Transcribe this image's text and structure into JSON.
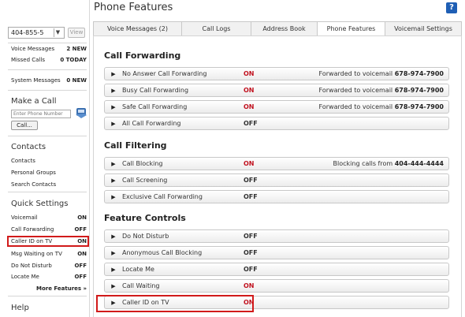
{
  "sidebar": {
    "phone_number": "404-855-5",
    "view_label": "View",
    "messages": [
      {
        "label": "Voice Messages",
        "value": "2 NEW"
      },
      {
        "label": "Missed Calls",
        "value": "0 TODAY"
      }
    ],
    "system_messages": {
      "label": "System Messages",
      "value": "0 NEW"
    },
    "make_call": {
      "heading": "Make a Call",
      "placeholder": "Enter Phone Number",
      "button": "Call..."
    },
    "contacts": {
      "heading": "Contacts",
      "links": [
        "Contacts",
        "Personal Groups",
        "Search Contacts"
      ]
    },
    "quick_settings": {
      "heading": "Quick Settings",
      "items": [
        {
          "label": "Voicemail",
          "value": "ON"
        },
        {
          "label": "Call Forwarding",
          "value": "OFF"
        },
        {
          "label": "Caller ID on TV",
          "value": "ON"
        },
        {
          "label": "Msg Waiting on TV",
          "value": "ON"
        },
        {
          "label": "Do Not Disturb",
          "value": "OFF"
        },
        {
          "label": "Locate Me",
          "value": "OFF"
        }
      ],
      "more": "More Features »"
    },
    "help": "Help"
  },
  "header": {
    "title": "Phone Features",
    "help_icon": "?"
  },
  "tabs": [
    "Voice Messages (2)",
    "Call Logs",
    "Address Book",
    "Phone Features",
    "Voicemail Settings"
  ],
  "sections": [
    {
      "title": "Call Forwarding",
      "rows": [
        {
          "name": "No Answer Call Forwarding",
          "status": "ON",
          "detail_text": "Forwarded to voicemail",
          "detail_bold": "678-974-7900"
        },
        {
          "name": "Busy Call Forwarding",
          "status": "ON",
          "detail_text": "Forwarded to voicemail",
          "detail_bold": "678-974-7900"
        },
        {
          "name": "Safe Call Forwarding",
          "status": "ON",
          "detail_text": "Forwarded to voicemail",
          "detail_bold": "678-974-7900"
        },
        {
          "name": "All Call Forwarding",
          "status": "OFF",
          "detail_text": "",
          "detail_bold": ""
        }
      ]
    },
    {
      "title": "Call Filtering",
      "rows": [
        {
          "name": "Call Blocking",
          "status": "ON",
          "detail_text": "Blocking calls from",
          "detail_bold": "404-444-4444"
        },
        {
          "name": "Call Screening",
          "status": "OFF",
          "detail_text": "",
          "detail_bold": ""
        },
        {
          "name": "Exclusive Call Forwarding",
          "status": "OFF",
          "detail_text": "",
          "detail_bold": ""
        }
      ]
    },
    {
      "title": "Feature Controls",
      "rows": [
        {
          "name": "Do Not Disturb",
          "status": "OFF",
          "detail_text": "",
          "detail_bold": ""
        },
        {
          "name": "Anonymous Call Blocking",
          "status": "OFF",
          "detail_text": "",
          "detail_bold": ""
        },
        {
          "name": "Locate Me",
          "status": "OFF",
          "detail_text": "",
          "detail_bold": ""
        },
        {
          "name": "Call Waiting",
          "status": "ON",
          "detail_text": "",
          "detail_bold": ""
        },
        {
          "name": "Caller ID on TV",
          "status": "ON",
          "detail_text": "",
          "detail_bold": ""
        }
      ]
    }
  ],
  "colors": {
    "on": "#c1121f",
    "highlight": "#d11a1a",
    "help": "#1f5fb5"
  }
}
